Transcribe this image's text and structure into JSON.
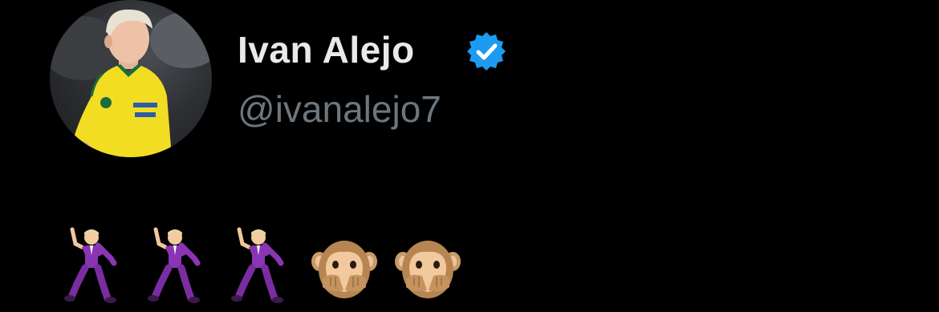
{
  "profile": {
    "display_name": "Ivan Alejo",
    "handle": "@ivanalejo7",
    "verified_icon": "verified-badge-icon",
    "avatar_icon": "profile-photo-avatar"
  },
  "tweet": {
    "emojis": [
      {
        "icon": "man-dancing-emoji",
        "char": "🕺"
      },
      {
        "icon": "man-dancing-emoji",
        "char": "🕺"
      },
      {
        "icon": "man-dancing-emoji",
        "char": "🕺"
      },
      {
        "icon": "speak-no-evil-monkey-emoji",
        "char": "🙊"
      },
      {
        "icon": "speak-no-evil-monkey-emoji",
        "char": "🙊"
      }
    ]
  },
  "colors": {
    "background": "#000000",
    "name_text": "#e9e9e9",
    "handle_text": "#6e767d",
    "verified_blue": "#1d9bf0"
  }
}
